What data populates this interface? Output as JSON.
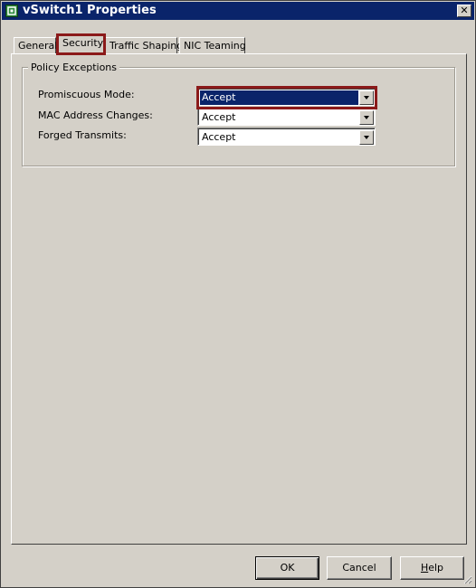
{
  "window": {
    "title": "vSwitch1 Properties",
    "close_label": "✕"
  },
  "tabs": [
    {
      "label": "General",
      "active": false
    },
    {
      "label": "Security",
      "active": true
    },
    {
      "label": "Traffic Shaping",
      "active": false
    },
    {
      "label": "NIC Teaming",
      "active": false
    }
  ],
  "policy": {
    "group_title": "Policy Exceptions",
    "fields": [
      {
        "label": "Promiscuous Mode:",
        "value": "Accept",
        "selected": true
      },
      {
        "label": "MAC Address Changes:",
        "value": "Accept",
        "selected": false
      },
      {
        "label": "Forged Transmits:",
        "value": "Accept",
        "selected": false
      }
    ]
  },
  "buttons": {
    "ok": "OK",
    "cancel": "Cancel",
    "help_prefix": "H",
    "help_rest": "elp"
  },
  "colors": {
    "titlebar": "#0a246a",
    "highlight_outline": "#8b1a1a",
    "selection": "#0a246a",
    "face": "#d4d0c8"
  }
}
